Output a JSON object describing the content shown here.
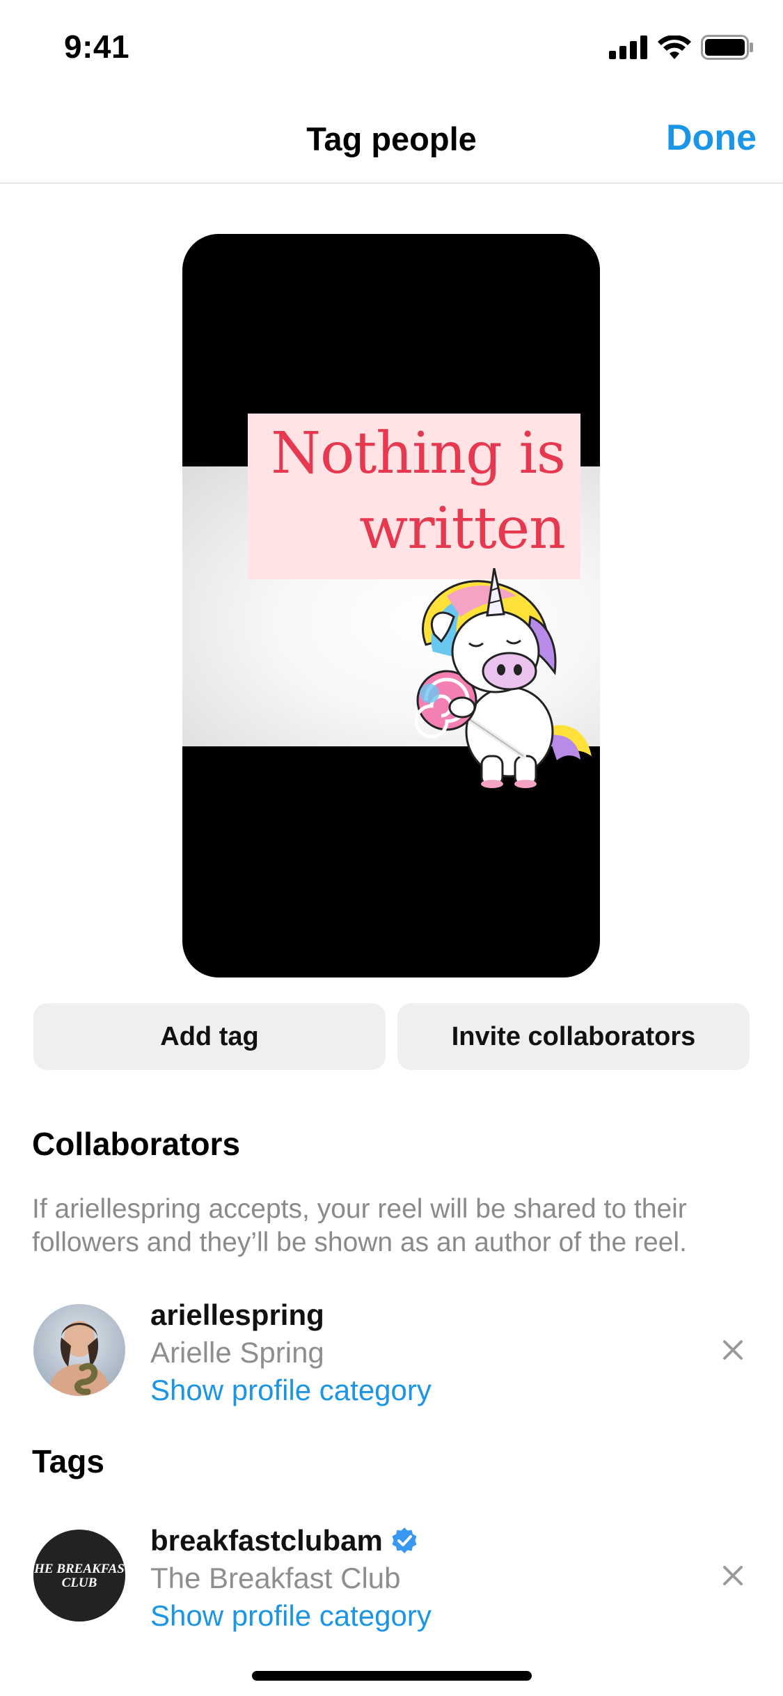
{
  "status_bar": {
    "time": "9:41",
    "icons": [
      "signal-icon",
      "wifi-icon",
      "battery-icon"
    ]
  },
  "nav": {
    "title": "Tag people",
    "done_label": "Done"
  },
  "preview": {
    "overlay_text_line1": "Nothing is",
    "overlay_text_line2": "written",
    "sticker": "unicorn-sticker",
    "text_color": "#e63950",
    "text_box_color": "#ffe3e5"
  },
  "actions": {
    "add_tag_label": "Add tag",
    "invite_label": "Invite collaborators"
  },
  "collaborators": {
    "heading": "Collaborators",
    "description": "If ariellespring accepts, your reel will be shared to their followers and they’ll be shown as an author of the reel.",
    "people": [
      {
        "username": "ariellespring",
        "full_name": "Arielle Spring",
        "category_link": "Show profile category",
        "verified": false
      }
    ]
  },
  "tags": {
    "heading": "Tags",
    "people": [
      {
        "username": "breakfastclubam",
        "full_name": "The Breakfast Club",
        "category_link": "Show profile category",
        "verified": true,
        "avatar_text": "THE BREAKFAST CLUB"
      }
    ]
  },
  "colors": {
    "accent": "#1b95e6",
    "button_bg": "#efefef",
    "secondary_text": "#8e8e8e"
  }
}
